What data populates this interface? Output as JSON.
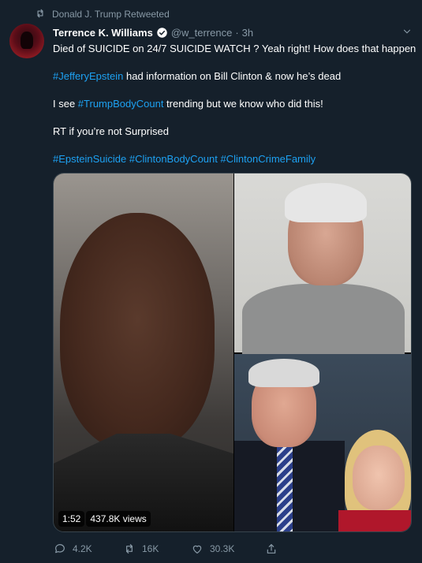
{
  "retweet_context": {
    "icon": "retweet-icon",
    "text": "Donald J. Trump Retweeted"
  },
  "author": {
    "display_name": "Terrence K. Williams",
    "verified": true,
    "handle": "@w_terrence",
    "separator": "·",
    "time": "3h"
  },
  "tweet": {
    "line1": "Died of SUICIDE on 24/7 SUICIDE WATCH ? Yeah right! How does that happen",
    "line2_hashtag": "#JefferyEpstein",
    "line2_rest": " had information on Bill Clinton & now he’s dead",
    "line3_pre": "I see ",
    "line3_hashtag": "#TrumpBodyCount",
    "line3_post": " trending but we know who did this!",
    "line4": "RT if you’re not Surprised",
    "hashtags": [
      "#EpsteinSuicide",
      "#ClintonBodyCount",
      "#ClintonCrimeFamily"
    ]
  },
  "media": {
    "duration": "1:52",
    "views": "437.8K views"
  },
  "actions": {
    "replies": "4.2K",
    "retweets": "16K",
    "likes": "30.3K"
  },
  "colors": {
    "background": "#15202b",
    "text": "#ffffff",
    "secondary": "#8899a6",
    "link": "#1da1f2",
    "verified": "#ffffff"
  }
}
